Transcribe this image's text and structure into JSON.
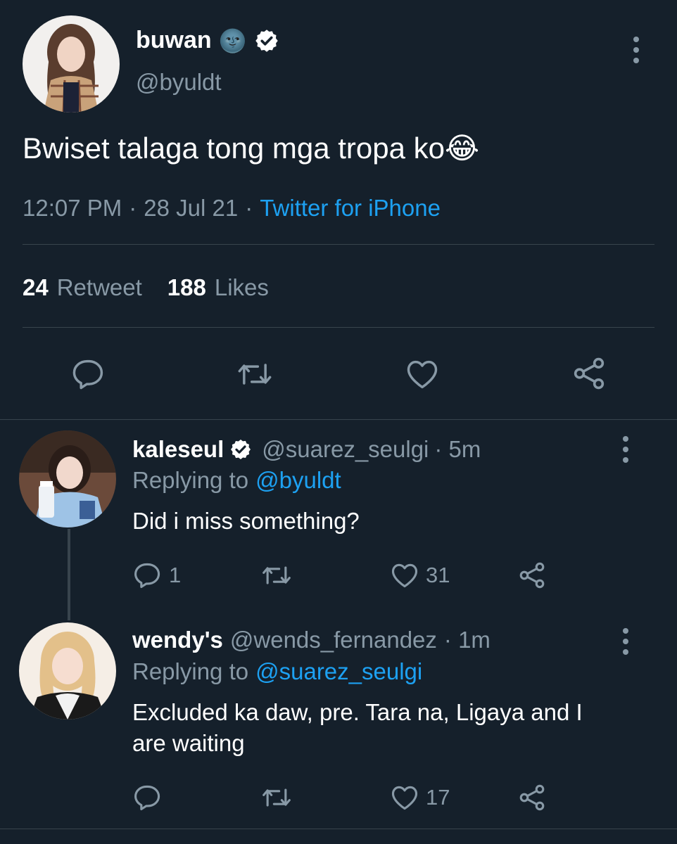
{
  "main_tweet": {
    "display_name": "buwan",
    "name_emoji": "🌚",
    "handle": "@byuldt",
    "text": "Bwiset talaga tong mga tropa ko😂",
    "time": "12:07 PM",
    "sep1": "·",
    "date": "28 Jul 21",
    "sep2": "·",
    "source": "Twitter for iPhone",
    "retweet_count": "24",
    "retweet_label": "Retweet",
    "likes_count": "188",
    "likes_label": "Likes"
  },
  "replies": [
    {
      "display_name": "kaleseul",
      "handle": "@suarez_seulgi",
      "time": "· 5m",
      "replying_prefix": "Replying to",
      "replying_to": "@byuldt",
      "text": "Did i miss something?",
      "reply_count": "1",
      "retweet_count": "",
      "like_count": "31"
    },
    {
      "display_name": "wendy's",
      "handle": "@wends_fernandez",
      "time": "· 1m",
      "replying_prefix": "Replying to",
      "replying_to": "@suarez_seulgi",
      "text_line1": "Excluded ka daw, pre. Tara na, Ligaya and I",
      "text_line2": "are waiting",
      "reply_count": "",
      "retweet_count": "",
      "like_count": "17"
    }
  ],
  "colors": {
    "background": "#15202b",
    "muted": "#8899a6",
    "link": "#1da1f2",
    "divider": "#38444d"
  },
  "icons": [
    "verified-badge-icon",
    "more-options-icon",
    "reply-icon",
    "retweet-icon",
    "like-icon",
    "share-icon"
  ]
}
